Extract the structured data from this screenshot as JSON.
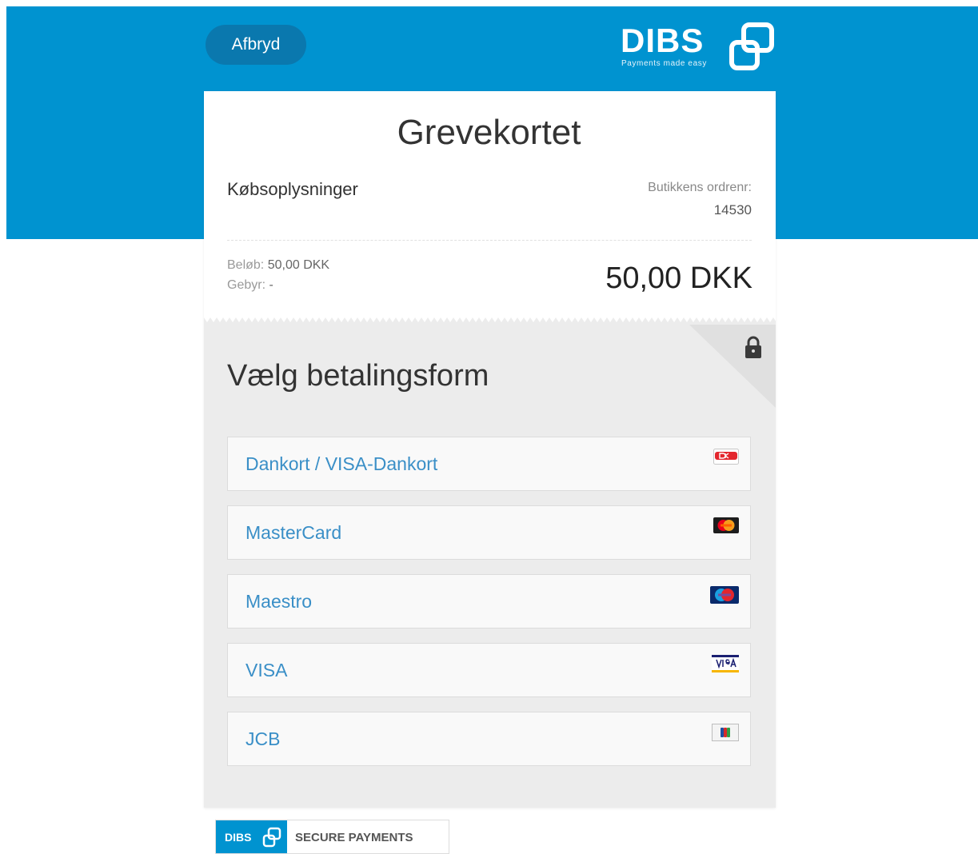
{
  "header": {
    "cancel_label": "Afbryd",
    "logo_word": "DIBS",
    "logo_tagline": "Payments made easy",
    "brand_color": "#0093d0"
  },
  "order": {
    "shop_name": "Grevekortet",
    "purchase_info_heading": "Købsoplysninger",
    "order_no_label": "Butikkens ordrenr:",
    "order_no_value": "14530",
    "amount_label": "Beløb:",
    "amount_value": "50,00 DKK",
    "fee_label": "Gebyr:",
    "fee_value": "-",
    "total": "50,00 DKK"
  },
  "payment": {
    "heading": "Vælg betalingsform",
    "lock_icon": "lock-icon",
    "link_color": "#3a8fc7",
    "methods": [
      {
        "label": "Dankort / VISA-Dankort",
        "icon": "dankort-logo-icon"
      },
      {
        "label": "MasterCard",
        "icon": "mastercard-logo-icon"
      },
      {
        "label": "Maestro",
        "icon": "maestro-logo-icon"
      },
      {
        "label": "VISA",
        "icon": "visa-logo-icon"
      },
      {
        "label": "JCB",
        "icon": "jcb-logo-icon"
      }
    ]
  },
  "footer": {
    "badge_word": "DIBS",
    "badge_text": "SECURE PAYMENTS"
  }
}
